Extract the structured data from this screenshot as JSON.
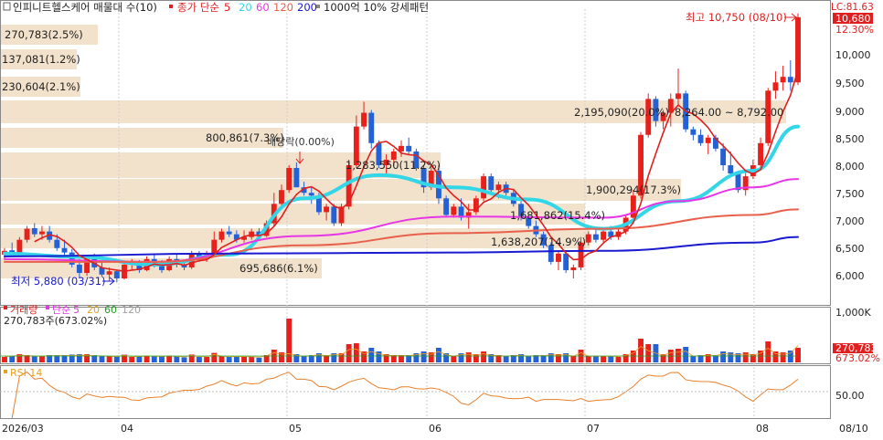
{
  "header": {
    "title": "인피니트헬스케어 매물대 수(10)",
    "ma_label": "종가 단순",
    "ma_periods": [
      "5",
      "20",
      "60",
      "120",
      "200"
    ],
    "ma_colors": [
      "#e02020",
      "#33d6e6",
      "#e636e6",
      "#e8604c",
      "#1a1ad0"
    ],
    "volume_profile_label": "1000억 10% 강세패턴",
    "lc_label": "LC:81.63"
  },
  "price_axis": {
    "ticks": [
      "10,000",
      "9,500",
      "9,000",
      "8,500",
      "8,000",
      "7,500",
      "7,000",
      "6,500",
      "6,000"
    ],
    "current_price": "10,680",
    "current_change": "12.30%"
  },
  "annotations": {
    "high": "최고 10,750 (08/10)",
    "low": "최저 5,880 (03/31)",
    "dividend": "배당락(0.00%)"
  },
  "volume_profile_labels": [
    "270,783(2.5%)",
    "137,081(1.2%)",
    "230,604(2.1%)",
    "2,195,090(20.0%)",
    "8,264.00 ~ 8,792.00",
    "800,861(7.3%)",
    "1,283,550(11.2%)",
    "1,900,294(17.3%)",
    "1,681,862(15.4%)",
    "1,638,207(14.9%)",
    "695,686(6.1%)"
  ],
  "volume_panel": {
    "label": "거래량",
    "ma_label": "단순",
    "ma_periods": [
      "5",
      "20",
      "60",
      "120"
    ],
    "ma_colors": [
      "#e636e6",
      "#e8a020",
      "#20a020",
      "#a0a0a0"
    ],
    "value_label": "270,783주(673.02%)",
    "axis_max": "1,000K",
    "current_value": "270,783",
    "current_pct": "673.02%"
  },
  "rsi_panel": {
    "label": "RSI 14",
    "axis": "50.00"
  },
  "date_labels": [
    "2026/03",
    "04",
    "05",
    "06",
    "07",
    "08",
    "08/10"
  ],
  "chart_data": {
    "type": "candlestick",
    "title": "인피니트헬스케어 매물대 수(10)",
    "ylim": [
      5700,
      10900
    ],
    "high": {
      "value": 10750,
      "date": "08/10"
    },
    "low": {
      "value": 5880,
      "date": "03/31"
    },
    "candles": [
      [
        6380,
        6500,
        6300,
        6450
      ],
      [
        6460,
        6600,
        6350,
        6380
      ],
      [
        6380,
        6700,
        6350,
        6650
      ],
      [
        6650,
        6900,
        6600,
        6850
      ],
      [
        6860,
        6950,
        6700,
        6750
      ],
      [
        6750,
        6900,
        6650,
        6800
      ],
      [
        6800,
        6900,
        6600,
        6650
      ],
      [
        6650,
        6750,
        6450,
        6500
      ],
      [
        6500,
        6650,
        6350,
        6420
      ],
      [
        6420,
        6480,
        6150,
        6200
      ],
      [
        6200,
        6300,
        5950,
        6050
      ],
      [
        6050,
        6350,
        6000,
        6300
      ],
      [
        6300,
        6400,
        6100,
        6150
      ],
      [
        6150,
        6250,
        5980,
        6020
      ],
      [
        6020,
        6150,
        5900,
        6080
      ],
      [
        6080,
        6100,
        5880,
        5950
      ],
      [
        5950,
        6250,
        5930,
        6200
      ],
      [
        6200,
        6300,
        6100,
        6250
      ],
      [
        6250,
        6280,
        6050,
        6100
      ],
      [
        6100,
        6350,
        6080,
        6300
      ],
      [
        6300,
        6400,
        6150,
        6200
      ],
      [
        6200,
        6280,
        6050,
        6100
      ],
      [
        6100,
        6350,
        6080,
        6300
      ],
      [
        6300,
        6380,
        6150,
        6200
      ],
      [
        6200,
        6280,
        6100,
        6150
      ],
      [
        6150,
        6450,
        6120,
        6400
      ],
      [
        6400,
        6450,
        6250,
        6300
      ],
      [
        6300,
        6450,
        6250,
        6400
      ],
      [
        6400,
        6800,
        6380,
        6650
      ],
      [
        6650,
        6850,
        6600,
        6800
      ],
      [
        6800,
        6900,
        6700,
        6750
      ],
      [
        6750,
        6820,
        6600,
        6650
      ],
      [
        6650,
        6820,
        6600,
        6700
      ],
      [
        6700,
        6850,
        6650,
        6800
      ],
      [
        6800,
        6860,
        6700,
        6720
      ],
      [
        6720,
        7000,
        6700,
        6950
      ],
      [
        6950,
        7500,
        6900,
        7300
      ],
      [
        7300,
        7650,
        7200,
        7550
      ],
      [
        7550,
        8000,
        7500,
        7950
      ],
      [
        7950,
        8050,
        7700,
        7600
      ],
      [
        7600,
        7700,
        7450,
        7500
      ],
      [
        7500,
        7600,
        7300,
        7450
      ],
      [
        7450,
        7500,
        7100,
        7150
      ],
      [
        7150,
        7300,
        7000,
        7250
      ],
      [
        7250,
        7300,
        6900,
        6950
      ],
      [
        6950,
        7300,
        6900,
        7250
      ],
      [
        7250,
        8100,
        7200,
        8000
      ],
      [
        8000,
        8900,
        7950,
        8700
      ],
      [
        8700,
        9150,
        8650,
        8950
      ],
      [
        8950,
        9000,
        8300,
        8400
      ],
      [
        8400,
        8450,
        7950,
        8000
      ],
      [
        8000,
        8200,
        7850,
        8100
      ],
      [
        8100,
        8300,
        8000,
        8250
      ],
      [
        8250,
        8450,
        8150,
        8350
      ],
      [
        8350,
        8500,
        8200,
        8250
      ],
      [
        8250,
        8300,
        7900,
        7950
      ],
      [
        7950,
        8000,
        7500,
        7600
      ],
      [
        7600,
        8000,
        7550,
        7900
      ],
      [
        7900,
        8000,
        7300,
        7400
      ],
      [
        7400,
        7450,
        7050,
        7100
      ],
      [
        7100,
        7300,
        7050,
        7250
      ],
      [
        7250,
        7400,
        7000,
        7050
      ],
      [
        7050,
        7300,
        6850,
        7150
      ],
      [
        7150,
        7450,
        7100,
        7400
      ],
      [
        7400,
        7850,
        7350,
        7800
      ],
      [
        7800,
        7850,
        7500,
        7550
      ],
      [
        7550,
        7700,
        7400,
        7650
      ],
      [
        7650,
        7700,
        7450,
        7500
      ],
      [
        7500,
        7550,
        7250,
        7300
      ],
      [
        7300,
        7350,
        7000,
        7050
      ],
      [
        7050,
        7100,
        6850,
        6900
      ],
      [
        6900,
        7000,
        6700,
        6750
      ],
      [
        6750,
        6800,
        6500,
        6550
      ],
      [
        6550,
        6600,
        6200,
        6250
      ],
      [
        6250,
        6450,
        6100,
        6400
      ],
      [
        6400,
        6450,
        6050,
        6100
      ],
      [
        6100,
        6200,
        5950,
        6150
      ],
      [
        6150,
        6700,
        6100,
        6600
      ],
      [
        6600,
        6800,
        6550,
        6750
      ],
      [
        6750,
        6850,
        6600,
        6650
      ],
      [
        6650,
        6850,
        6600,
        6800
      ],
      [
        6800,
        6900,
        6650,
        6700
      ],
      [
        6700,
        6850,
        6650,
        6800
      ],
      [
        6800,
        7100,
        6750,
        7050
      ],
      [
        7050,
        7550,
        7000,
        7450
      ],
      [
        7450,
        8600,
        7400,
        8550
      ],
      [
        8550,
        9300,
        8500,
        9200
      ],
      [
        9200,
        9250,
        8700,
        8800
      ],
      [
        8800,
        9000,
        8650,
        8950
      ],
      [
        8950,
        9300,
        8700,
        9200
      ],
      [
        9200,
        9750,
        9100,
        9300
      ],
      [
        9300,
        9350,
        8600,
        8650
      ],
      [
        8650,
        8700,
        8450,
        8550
      ],
      [
        8550,
        8650,
        8350,
        8400
      ],
      [
        8400,
        8550,
        8200,
        8500
      ],
      [
        8500,
        8550,
        8250,
        8300
      ],
      [
        8300,
        8400,
        7900,
        8000
      ],
      [
        8000,
        8250,
        7800,
        7850
      ],
      [
        7850,
        7900,
        7500,
        7550
      ],
      [
        7550,
        7900,
        7450,
        7800
      ],
      [
        7800,
        8100,
        7750,
        8000
      ],
      [
        8000,
        8500,
        7950,
        8400
      ],
      [
        8400,
        9400,
        8350,
        9350
      ],
      [
        9350,
        9700,
        9200,
        9500
      ],
      [
        9500,
        9800,
        9350,
        9600
      ],
      [
        9600,
        9900,
        9350,
        9500
      ],
      [
        9500,
        10750,
        9450,
        10680
      ]
    ],
    "moving_averages": [
      {
        "period": 20,
        "color": "#33d6e6",
        "points": [
          [
            0,
            6400
          ],
          [
            10,
            6340
          ],
          [
            20,
            6200
          ],
          [
            30,
            6380
          ],
          [
            40,
            7400
          ],
          [
            50,
            7820
          ],
          [
            60,
            7600
          ],
          [
            70,
            7380
          ],
          [
            80,
            6850
          ],
          [
            90,
            7350
          ],
          [
            100,
            7900
          ],
          [
            106,
            8700
          ]
        ]
      },
      {
        "period": 60,
        "color": "#e636e6",
        "points": [
          [
            0,
            6300
          ],
          [
            20,
            6250
          ],
          [
            40,
            6720
          ],
          [
            60,
            7070
          ],
          [
            80,
            7050
          ],
          [
            90,
            7350
          ],
          [
            100,
            7600
          ],
          [
            106,
            7750
          ]
        ]
      },
      {
        "period": 120,
        "color": "#e8604c",
        "points": [
          [
            0,
            6250
          ],
          [
            20,
            6250
          ],
          [
            40,
            6550
          ],
          [
            60,
            6770
          ],
          [
            80,
            6850
          ],
          [
            100,
            7100
          ],
          [
            106,
            7200
          ]
        ]
      },
      {
        "period": 200,
        "color": "#1a1ad0",
        "points": [
          [
            0,
            6350
          ],
          [
            30,
            6400
          ],
          [
            60,
            6420
          ],
          [
            80,
            6450
          ],
          [
            100,
            6600
          ],
          [
            106,
            6700
          ]
        ]
      }
    ]
  }
}
